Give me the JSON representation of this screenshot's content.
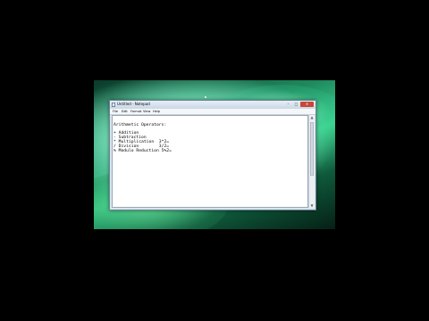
{
  "window": {
    "title": "Untitled - Notepad",
    "controls": {
      "minimize": "–",
      "maximize": "□",
      "close": "✕"
    }
  },
  "menu": [
    "File",
    "Edit",
    "Format",
    "View",
    "Help"
  ],
  "editor": {
    "lines": [
      "",
      "Arithmetic Operators:",
      "",
      "+ Addition",
      "- Subtraction",
      "* Multiplication  3*2=",
      "/ Division        3/2=",
      "% Modulo Reduction 5%2="
    ]
  },
  "scrollbar": {
    "up": "▲",
    "down": "▼"
  },
  "icons": {
    "app": "notepad-icon"
  }
}
